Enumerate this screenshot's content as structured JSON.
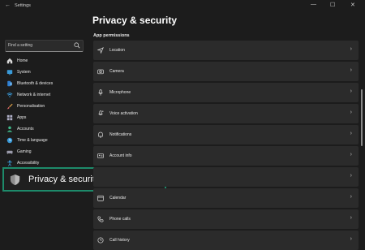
{
  "window": {
    "back_glyph": "←",
    "title": "Settings",
    "min": "—",
    "max": "☐",
    "close": "✕"
  },
  "search": {
    "placeholder": "Find a setting"
  },
  "sidebar": {
    "items": [
      {
        "label": "Home",
        "icon": "home-icon"
      },
      {
        "label": "System",
        "icon": "system-icon"
      },
      {
        "label": "Bluetooth & devices",
        "icon": "bluetooth-icon"
      },
      {
        "label": "Network & internet",
        "icon": "wifi-icon"
      },
      {
        "label": "Personalisation",
        "icon": "brush-icon"
      },
      {
        "label": "Apps",
        "icon": "apps-icon"
      },
      {
        "label": "Accounts",
        "icon": "person-icon"
      },
      {
        "label": "Time & language",
        "icon": "clock-icon"
      },
      {
        "label": "Gaming",
        "icon": "gamepad-icon"
      },
      {
        "label": "Accessibility",
        "icon": "accessibility-icon"
      }
    ],
    "highlighted": {
      "label": "Privacy & security",
      "icon": "shield-icon"
    }
  },
  "main": {
    "title": "Privacy & security",
    "section": "App permissions",
    "chevron": "›",
    "rows": [
      {
        "label": "Location",
        "icon": "location-icon"
      },
      {
        "label": "Camera",
        "icon": "camera-icon"
      },
      {
        "label": "Microphone",
        "icon": "microphone-icon"
      },
      {
        "label": "Voice activation",
        "icon": "voice-activation-icon"
      },
      {
        "label": "Notifications",
        "icon": "bell-icon"
      },
      {
        "label": "Account info",
        "icon": "account-info-icon"
      },
      {
        "label": "",
        "icon": ""
      },
      {
        "label": "Calendar",
        "icon": "calendar-icon"
      },
      {
        "label": "Phone calls",
        "icon": "phone-icon"
      },
      {
        "label": "Call history",
        "icon": "call-history-icon"
      }
    ]
  },
  "colors": {
    "accent": "#1d8a6a",
    "background": "#1c1c1c",
    "card": "#2b2b2b"
  }
}
